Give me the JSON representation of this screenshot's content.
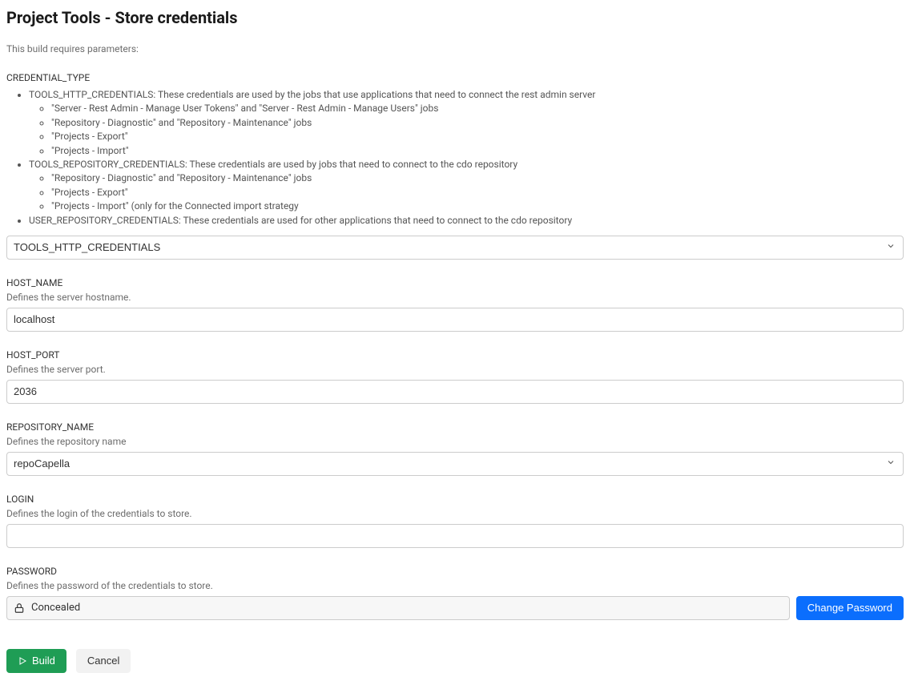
{
  "title": "Project Tools - Store credentials",
  "intro": "This build requires parameters:",
  "credential_type": {
    "label": "CREDENTIAL_TYPE",
    "sections": [
      {
        "head": "TOOLS_HTTP_CREDENTIALS: These credentials are used by the jobs that use applications that need to connect the rest admin server",
        "items": [
          "\"Server - Rest Admin - Manage User Tokens\" and \"Server - Rest Admin - Manage Users\" jobs",
          "\"Repository - Diagnostic\" and \"Repository - Maintenance\" jobs",
          "\"Projects - Export\"",
          "\"Projects - Import\""
        ]
      },
      {
        "head": "TOOLS_REPOSITORY_CREDENTIALS: These credentials are used by jobs that need to connect to the cdo repository",
        "items": [
          "\"Repository - Diagnostic\" and \"Repository - Maintenance\" jobs",
          "\"Projects - Export\"",
          "\"Projects - Import\" (only for the Connected import strategy"
        ]
      },
      {
        "head": "USER_REPOSITORY_CREDENTIALS: These credentials are used for other applications that need to connect to the cdo repository",
        "items": []
      }
    ],
    "selected": "TOOLS_HTTP_CREDENTIALS",
    "options": [
      "TOOLS_HTTP_CREDENTIALS",
      "TOOLS_REPOSITORY_CREDENTIALS",
      "USER_REPOSITORY_CREDENTIALS"
    ]
  },
  "host_name": {
    "label": "HOST_NAME",
    "desc": "Defines the server hostname.",
    "value": "localhost"
  },
  "host_port": {
    "label": "HOST_PORT",
    "desc": "Defines the server port.",
    "value": "2036"
  },
  "repository_name": {
    "label": "REPOSITORY_NAME",
    "desc": "Defines the repository name",
    "selected": "repoCapella",
    "options": [
      "repoCapella"
    ]
  },
  "login": {
    "label": "LOGIN",
    "desc": "Defines the login of the credentials to store.",
    "value": ""
  },
  "password": {
    "label": "PASSWORD",
    "desc": "Defines the password of the credentials to store.",
    "status": "Concealed",
    "change_label": "Change Password"
  },
  "actions": {
    "build": "Build",
    "cancel": "Cancel"
  }
}
